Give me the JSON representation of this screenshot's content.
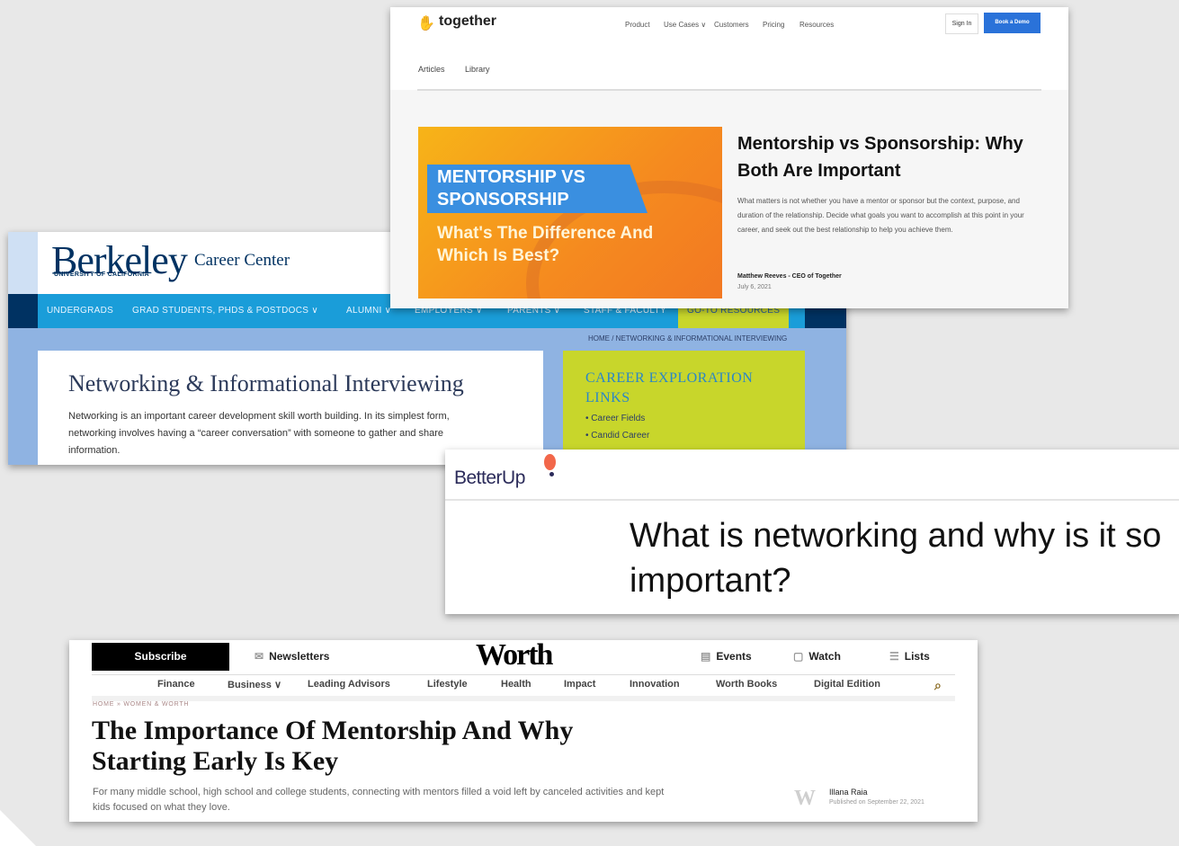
{
  "berkeley": {
    "logo": "Berkeley",
    "logo_sub": "UNIVERSITY OF CALIFORNIA",
    "site_name": "Career Center",
    "nav": [
      "UNDERGRADS",
      "GRAD STUDENTS, PHDS & POSTDOCS ∨",
      "ALUMNI ∨",
      "EMPLOYERS ∨",
      "PARENTS ∨",
      "STAFF & FACULTY",
      "GO-TO RESOURCES"
    ],
    "breadcrumb": "HOME / NETWORKING & INFORMATIONAL INTERVIEWING",
    "title": "Networking & Informational Interviewing",
    "body": "Networking is an important career development skill worth building. In its simplest form, networking involves having a “career conversation” with someone to gather and share information.",
    "sidebar": {
      "heading": "CAREER EXPLORATION LINKS",
      "links": [
        "• Career Fields",
        "• Candid Career"
      ]
    }
  },
  "together": {
    "logo": "together",
    "nav": [
      "Product",
      "Use Cases ∨",
      "Customers",
      "Pricing",
      "Resources"
    ],
    "signin": "Sign In",
    "demo": "Book a Demo",
    "subnav": [
      "Articles",
      "Library"
    ],
    "hero_band": "MENTORSHIP VS SPONSORSHIP",
    "hero_sub": "What's The Difference And Which Is Best?",
    "title": "Mentorship vs Sponsorship: Why Both Are Important",
    "body": "What matters is not whether you have a mentor or sponsor but the context, purpose, and duration of the relationship. Decide what goals you want to accomplish at this point in your career, and seek out the best relationship to help you achieve them.",
    "author": "Matthew Reeves - CEO of Together",
    "date": "July 6, 2021"
  },
  "betterup": {
    "logo": "BetterUp",
    "title": "What is networking and why is it so important?"
  },
  "worth": {
    "subscribe": "Subscribe",
    "newsletters": "Newsletters",
    "logo": "Worth",
    "events": "Events",
    "watch": "Watch",
    "lists": "Lists",
    "nav": [
      "Finance",
      "Business ∨",
      "Leading Advisors",
      "Lifestyle",
      "Health",
      "Impact",
      "Innovation",
      "Worth Books",
      "Digital Edition"
    ],
    "breadcrumb": "HOME » WOMEN & WORTH",
    "title": "The Importance Of Mentorship And Why Starting Early Is Key",
    "dek": "For many middle school, high school and college students, connecting with mentors filled a void left by canceled activities and kept kids focused on what they love.",
    "author": "Illana Raia",
    "published": "Published on September 22, 2021"
  }
}
